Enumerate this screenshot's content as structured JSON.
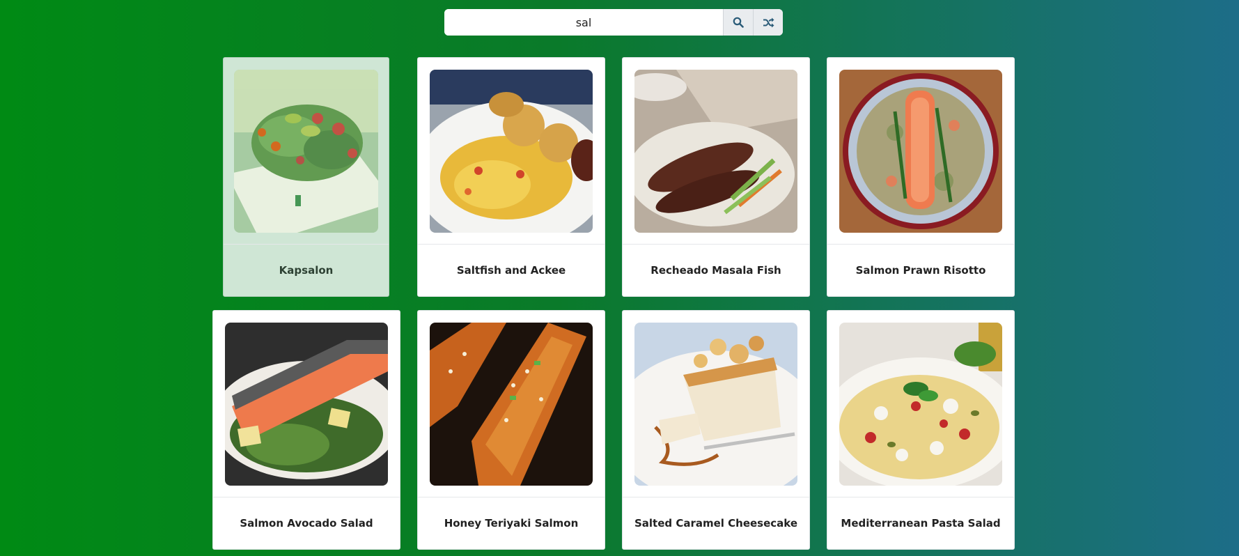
{
  "search": {
    "value": "sal",
    "placeholder": "Search meals"
  },
  "meals": [
    {
      "name": "Kapsalon",
      "image": "kapsalon-photo",
      "state": "hovered"
    },
    {
      "name": "Saltfish and Ackee",
      "image": "saltfish-ackee-photo"
    },
    {
      "name": "Recheado Masala Fish",
      "image": "masala-fish-photo"
    },
    {
      "name": "Salmon Prawn Risotto",
      "image": "salmon-risotto-photo"
    },
    {
      "name": "Salmon Avocado Salad",
      "image": "salmon-avocado-photo"
    },
    {
      "name": "Honey Teriyaki Salmon",
      "image": "teriyaki-salmon-photo"
    },
    {
      "name": "Salted Caramel Cheesecake",
      "image": "caramel-cheesecake-photo"
    },
    {
      "name": "Mediterranean Pasta Salad",
      "image": "pasta-salad-photo"
    }
  ],
  "colors": {
    "bg_left": "#008a14",
    "bg_right": "#1d6d88",
    "hover_card": "#cfe6d5",
    "button_bg": "#e9ecef",
    "icon": "#2a5b78"
  },
  "icons": {
    "search": "search-icon",
    "random": "shuffle-icon"
  }
}
